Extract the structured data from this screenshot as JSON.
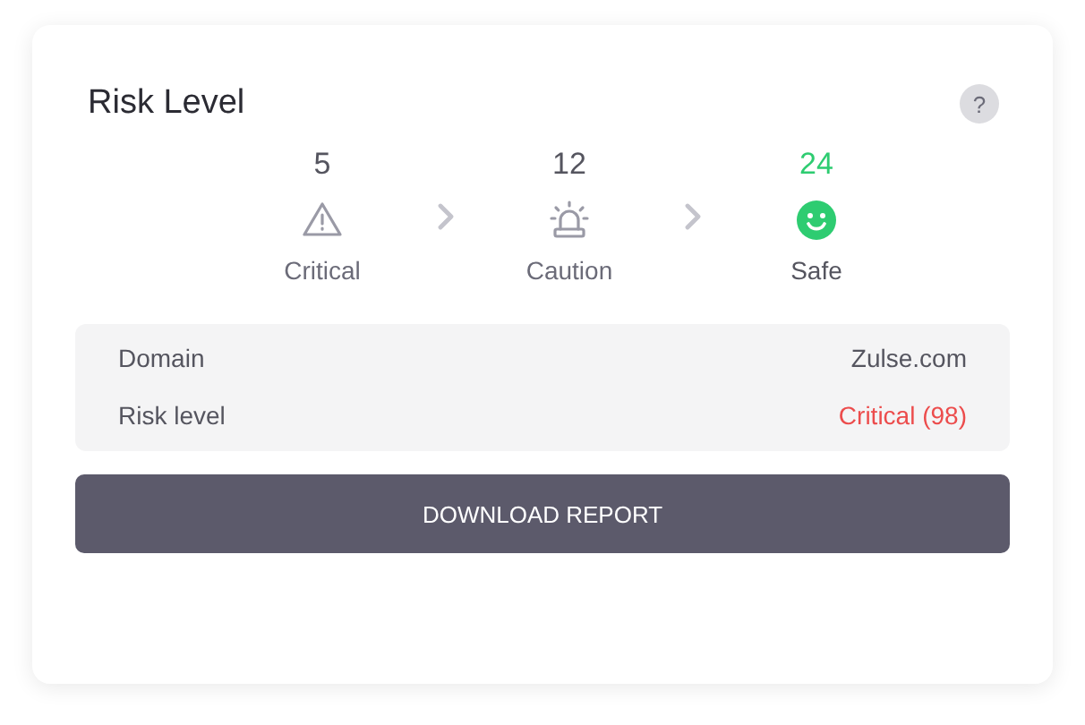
{
  "title": "Risk Level",
  "help": "?",
  "levels": [
    {
      "kind": "critical",
      "count": "5",
      "label": "Critical",
      "selected": false
    },
    {
      "kind": "caution",
      "count": "12",
      "label": "Caution",
      "selected": false
    },
    {
      "kind": "safe",
      "count": "24",
      "label": "Safe",
      "selected": true
    }
  ],
  "details": [
    {
      "label": "Domain",
      "value": "Zulse.com",
      "alert": false
    },
    {
      "label": "Risk level",
      "value": "Critical (98)",
      "alert": true
    }
  ],
  "button": "DOWNLOAD REPORT"
}
